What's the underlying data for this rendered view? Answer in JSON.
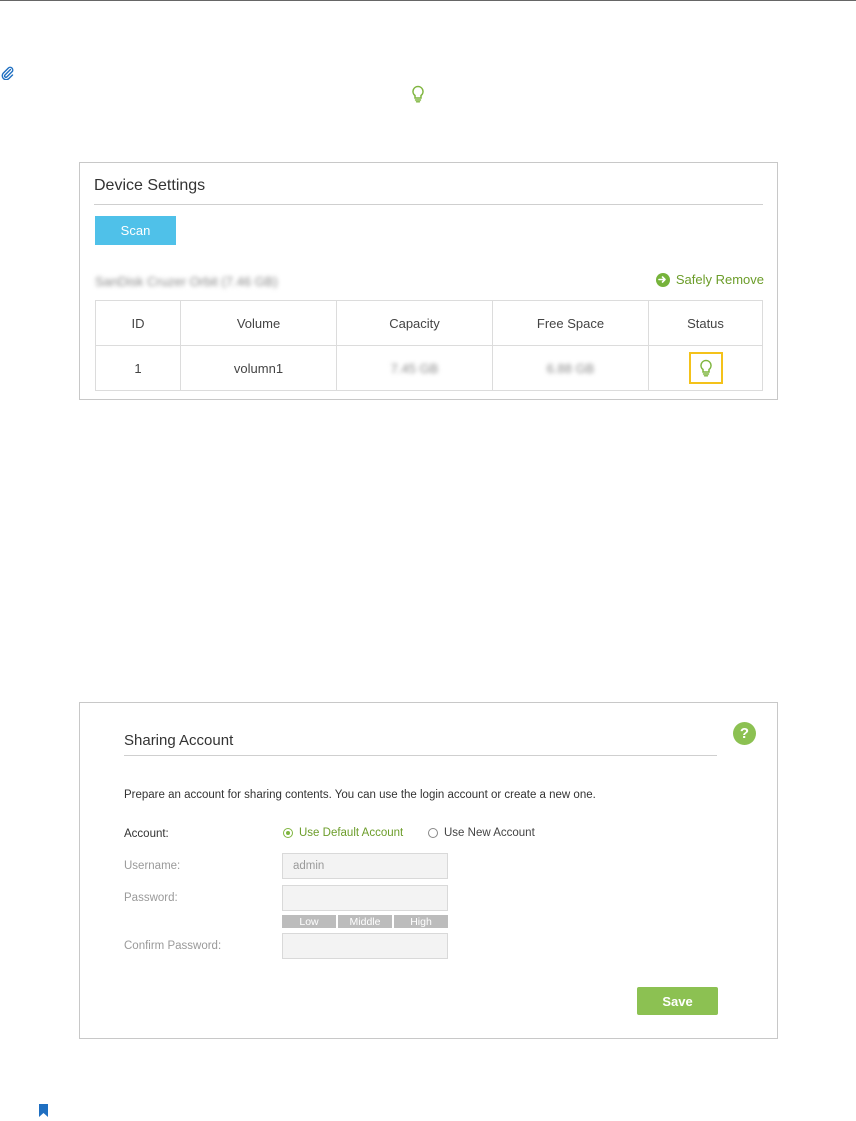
{
  "device_settings": {
    "title": "Device Settings",
    "scan_label": "Scan",
    "device_name": "SanDisk Cruzer Orbit (7.46 GB)",
    "safely_remove_label": "Safely Remove",
    "table": {
      "headers": [
        "ID",
        "Volume",
        "Capacity",
        "Free Space",
        "Status"
      ],
      "rows": [
        {
          "id": "1",
          "volume": "volumn1",
          "capacity": "7.45 GB",
          "free_space": "6.88 GB",
          "status_icon": "bulb-icon"
        }
      ]
    }
  },
  "sharing_account": {
    "title": "Sharing Account",
    "help_label": "?",
    "description": "Prepare an account for sharing contents. You can use the login account or create a new one.",
    "account_label": "Account:",
    "options": [
      "Use Default Account",
      "Use New Account"
    ],
    "selected_option": "Use Default Account",
    "username_label": "Username:",
    "username_value": "admin",
    "password_label": "Password:",
    "password_strength": [
      "Low",
      "Middle",
      "High"
    ],
    "confirm_password_label": "Confirm Password:",
    "save_label": "Save"
  },
  "colors": {
    "scan_button": "#4fc1e9",
    "accent_green": "#8cc152",
    "status_highlight": "#f4c21a"
  }
}
